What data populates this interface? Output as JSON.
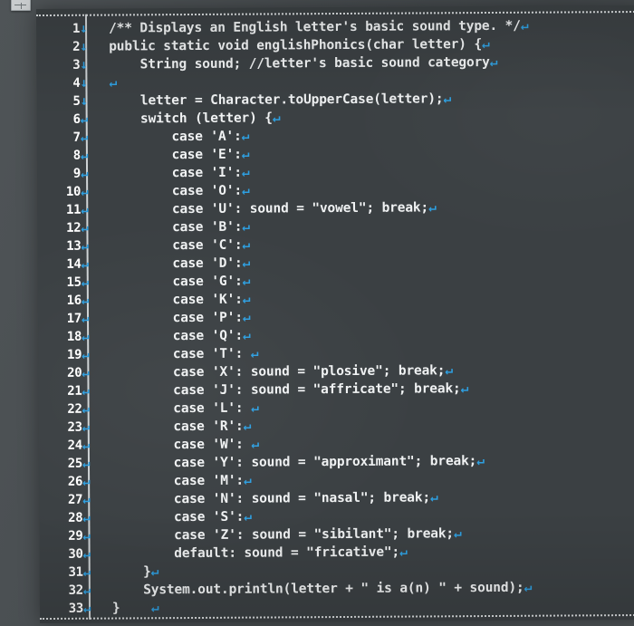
{
  "window": {
    "corner_icon": "window-control-icon",
    "background_color": "#4a4f52",
    "editor_background_color": "#3b4043",
    "code_text_color": "#f0f2f3",
    "line_number_color": "#ffffff",
    "eol_marker_color": "#2e9fe0",
    "eol_glyph_return": "↵",
    "eol_glyph_down": "↓"
  },
  "editor": {
    "language": "Java",
    "lines": [
      {
        "number": "1",
        "gutter_glyph": "↓",
        "text": "/** Displays an English letter's basic sound type. */",
        "eol": "↵"
      },
      {
        "number": "2",
        "gutter_glyph": "↓",
        "text": "public static void englishPhonics(char letter) {",
        "eol": "↵"
      },
      {
        "number": "3",
        "gutter_glyph": "↓",
        "text": "    String sound; //letter's basic sound category",
        "eol": "↵"
      },
      {
        "number": "4",
        "gutter_glyph": "↓",
        "text": "",
        "eol": "↵"
      },
      {
        "number": "5",
        "gutter_glyph": "↓",
        "text": "    letter = Character.toUpperCase(letter);",
        "eol": "↵"
      },
      {
        "number": "6",
        "gutter_glyph": "↵",
        "text": "    switch (letter) {",
        "eol": "↵"
      },
      {
        "number": "7",
        "gutter_glyph": "↵",
        "text": "        case 'A':",
        "eol": "↵"
      },
      {
        "number": "8",
        "gutter_glyph": "↵",
        "text": "        case 'E':",
        "eol": "↵"
      },
      {
        "number": "9",
        "gutter_glyph": "↵",
        "text": "        case 'I':",
        "eol": "↵"
      },
      {
        "number": "10",
        "gutter_glyph": "↵",
        "text": "        case 'O':",
        "eol": "↵"
      },
      {
        "number": "11",
        "gutter_glyph": "↵",
        "text": "        case 'U': sound = \"vowel\"; break;",
        "eol": "↵"
      },
      {
        "number": "12",
        "gutter_glyph": "↵",
        "text": "        case 'B':",
        "eol": "↵"
      },
      {
        "number": "13",
        "gutter_glyph": "↵",
        "text": "        case 'C':",
        "eol": "↵"
      },
      {
        "number": "14",
        "gutter_glyph": "↵",
        "text": "        case 'D':",
        "eol": "↵"
      },
      {
        "number": "15",
        "gutter_glyph": "↵",
        "text": "        case 'G':",
        "eol": "↵"
      },
      {
        "number": "16",
        "gutter_glyph": "↵",
        "text": "        case 'K':",
        "eol": "↵"
      },
      {
        "number": "17",
        "gutter_glyph": "↵",
        "text": "        case 'P':",
        "eol": "↵"
      },
      {
        "number": "18",
        "gutter_glyph": "↵",
        "text": "        case 'Q':",
        "eol": "↵"
      },
      {
        "number": "19",
        "gutter_glyph": "↵",
        "text": "        case 'T': ",
        "eol": "↵"
      },
      {
        "number": "20",
        "gutter_glyph": "↵",
        "text": "        case 'X': sound = \"plosive\"; break;",
        "eol": "↵"
      },
      {
        "number": "21",
        "gutter_glyph": "↵",
        "text": "        case 'J': sound = \"affricate\"; break;",
        "eol": "↵"
      },
      {
        "number": "22",
        "gutter_glyph": "↵",
        "text": "        case 'L': ",
        "eol": "↵"
      },
      {
        "number": "23",
        "gutter_glyph": "↵",
        "text": "        case 'R':",
        "eol": "↵"
      },
      {
        "number": "24",
        "gutter_glyph": "↵",
        "text": "        case 'W': ",
        "eol": "↵"
      },
      {
        "number": "25",
        "gutter_glyph": "↵",
        "text": "        case 'Y': sound = \"approximant\"; break;",
        "eol": "↵"
      },
      {
        "number": "26",
        "gutter_glyph": "↵",
        "text": "        case 'M':",
        "eol": "↵"
      },
      {
        "number": "27",
        "gutter_glyph": "↵",
        "text": "        case 'N': sound = \"nasal\"; break;",
        "eol": "↵"
      },
      {
        "number": "28",
        "gutter_glyph": "↵",
        "text": "        case 'S':",
        "eol": "↵"
      },
      {
        "number": "29",
        "gutter_glyph": "↵",
        "text": "        case 'Z': sound = \"sibilant\"; break;",
        "eol": "↵"
      },
      {
        "number": "30",
        "gutter_glyph": "↵",
        "text": "        default: sound = \"fricative\";",
        "eol": "↵"
      },
      {
        "number": "31",
        "gutter_glyph": "↵",
        "text": "    }",
        "eol": "↵"
      },
      {
        "number": "32",
        "gutter_glyph": "↵",
        "text": "    System.out.println(letter + \" is a(n) \" + sound);",
        "eol": "↵"
      },
      {
        "number": "33",
        "gutter_glyph": "↵",
        "text": "}    ",
        "eol": "↵"
      }
    ]
  }
}
